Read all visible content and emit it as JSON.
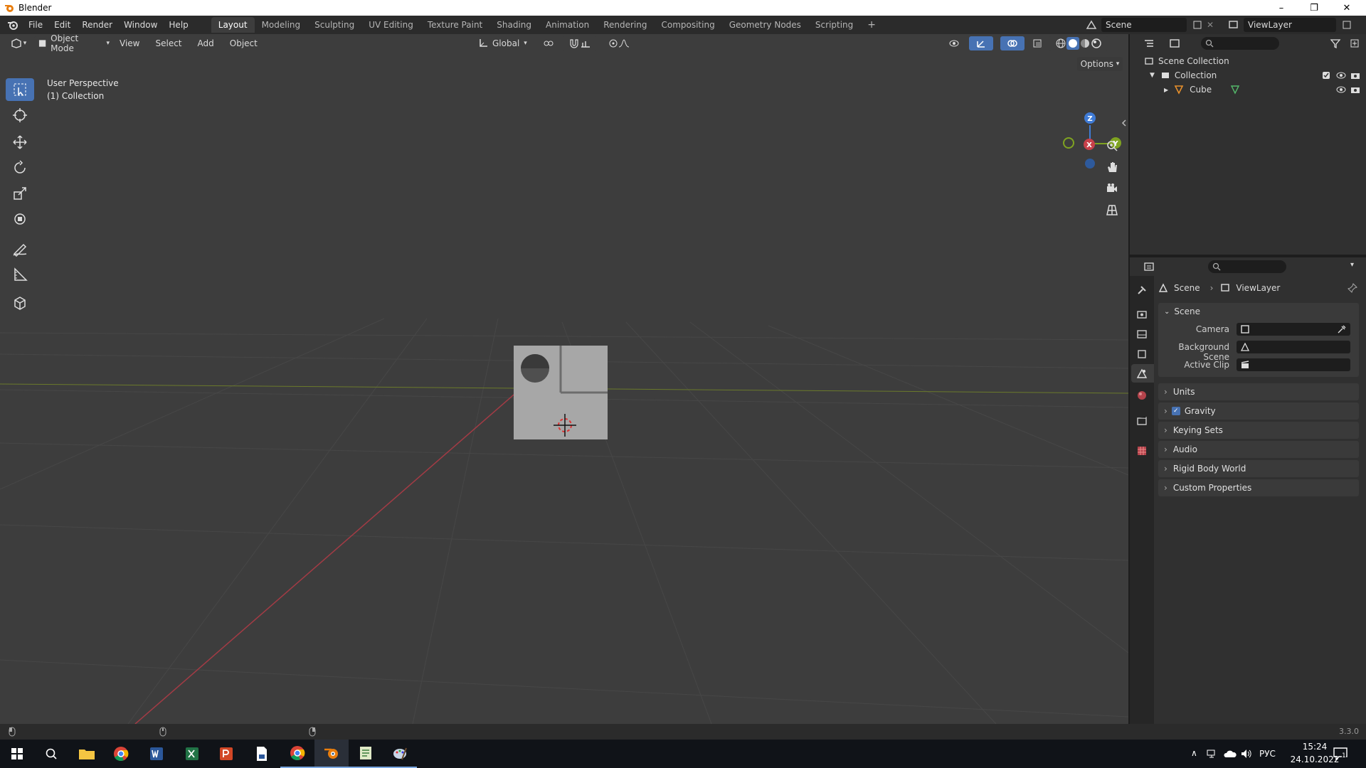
{
  "window": {
    "title": "Blender",
    "minimize": "–",
    "restore": "❐",
    "close": "✕"
  },
  "menu": [
    "File",
    "Edit",
    "Render",
    "Window",
    "Help"
  ],
  "workspaces": [
    "Layout",
    "Modeling",
    "Sculpting",
    "UV Editing",
    "Texture Paint",
    "Shading",
    "Animation",
    "Rendering",
    "Compositing",
    "Geometry Nodes",
    "Scripting"
  ],
  "add_workspace": "+",
  "scene_name": "Scene",
  "view_layer_name": "ViewLayer",
  "viewport": {
    "mode": "Object Mode",
    "menus": [
      "View",
      "Select",
      "Add",
      "Object"
    ],
    "transform_orientation": "Global",
    "options_label": "Options",
    "overlay_line1": "User Perspective",
    "overlay_line2": "(1) Collection",
    "gizmo": {
      "z": "Z",
      "y": "Y",
      "x": "X"
    }
  },
  "outliner": {
    "items": [
      {
        "label": "Scene Collection"
      },
      {
        "label": "Collection"
      },
      {
        "label": "Cube"
      }
    ]
  },
  "properties": {
    "breadcrumb": [
      "Scene",
      "ViewLayer"
    ],
    "section": "Scene",
    "fields": [
      {
        "label": "Camera"
      },
      {
        "label": "Background Scene"
      },
      {
        "label": "Active Clip"
      }
    ],
    "panels": [
      "Units",
      "Gravity",
      "Keying Sets",
      "Audio",
      "Rigid Body World",
      "Custom Properties"
    ]
  },
  "status": {
    "version": "3.3.0"
  },
  "taskbar": {
    "lang": "РУС",
    "time": "15:24",
    "date": "24.10.2022",
    "notif": "1"
  },
  "colors": {
    "accent": "#4772b3",
    "x_axis": "#c8414a",
    "y_axis": "#7fa321",
    "z_axis": "#3f7bd6"
  }
}
